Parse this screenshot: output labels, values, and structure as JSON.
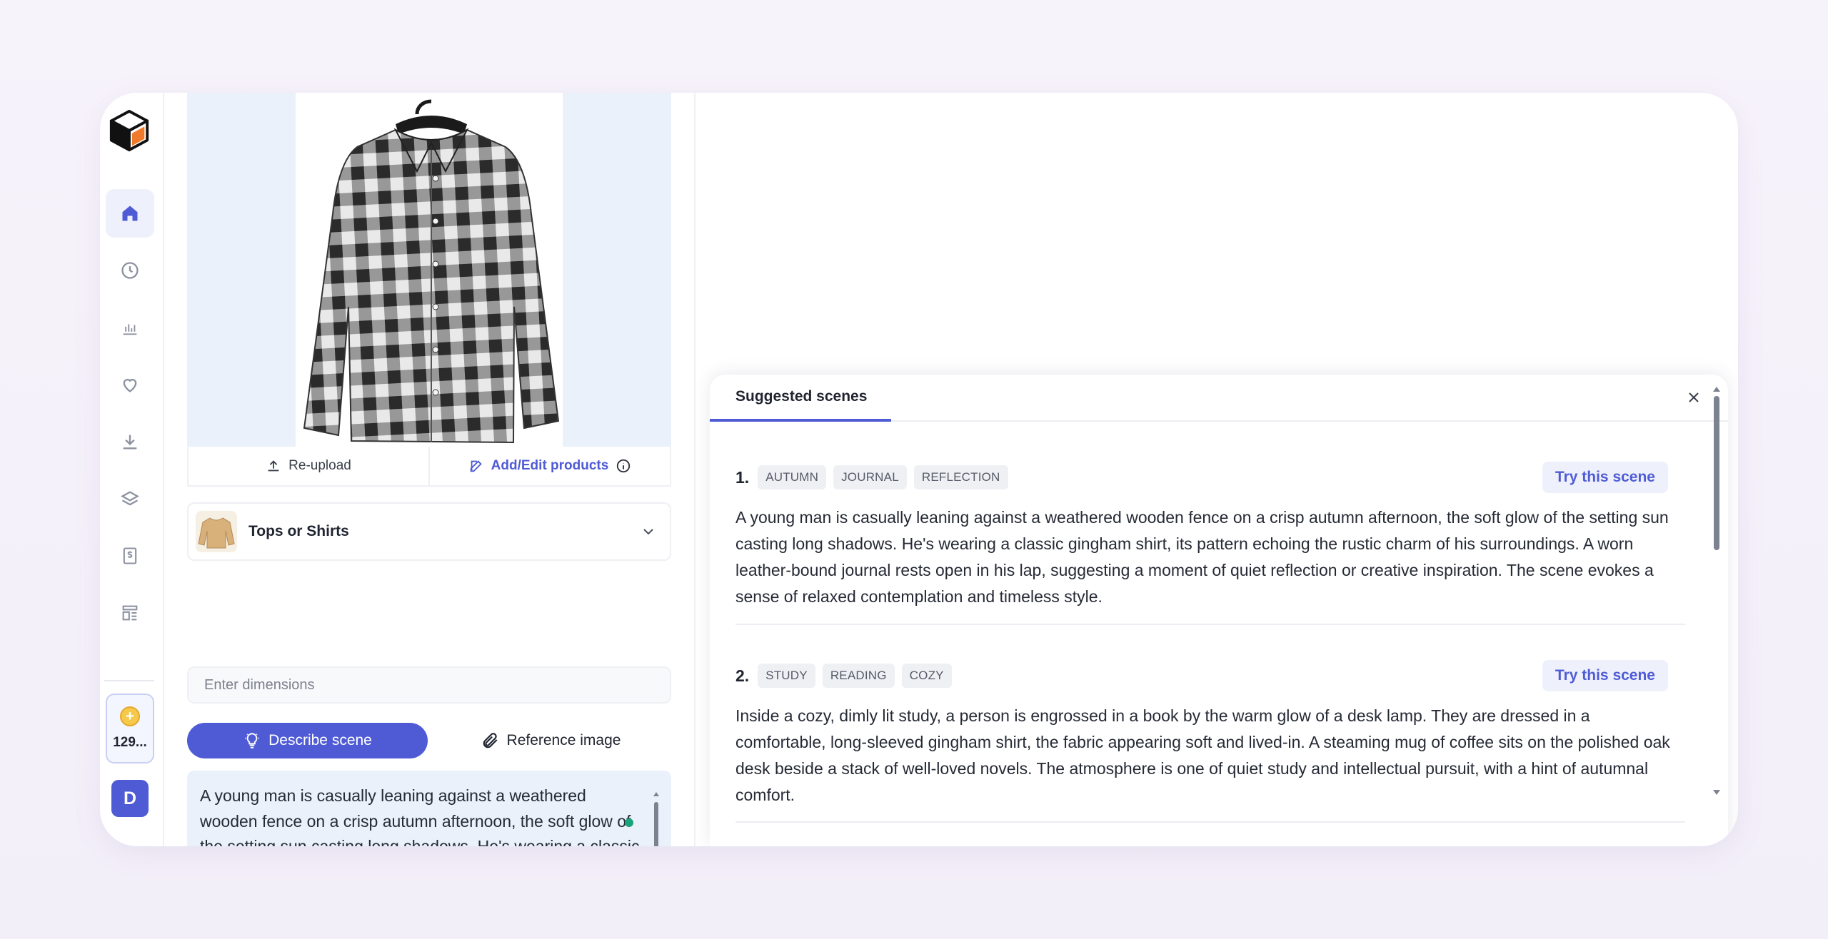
{
  "nav": {
    "items": [
      {
        "name": "home",
        "icon": "home-icon",
        "active": true
      },
      {
        "name": "history",
        "icon": "clock-icon",
        "active": false
      },
      {
        "name": "analytics",
        "icon": "bar-chart-icon",
        "active": false
      },
      {
        "name": "favorites",
        "icon": "heart-icon",
        "active": false
      },
      {
        "name": "downloads",
        "icon": "download-icon",
        "active": false
      },
      {
        "name": "layers",
        "icon": "layers-icon",
        "active": false
      },
      {
        "name": "billing",
        "icon": "dollar-document-icon",
        "active": false
      },
      {
        "name": "templates",
        "icon": "layout-list-icon",
        "active": false
      }
    ],
    "credits": "129...",
    "avatar_initial": "D"
  },
  "image_actions": {
    "reupload": "Re-upload",
    "add_edit": "Add/Edit products"
  },
  "category": {
    "label": "Tops or Shirts"
  },
  "dimensions": {
    "placeholder": "Enter dimensions"
  },
  "mode_tabs": {
    "describe": "Describe scene",
    "reference": "Reference image"
  },
  "description": "A young man is casually leaning against a weathered wooden fence on a crisp autumn afternoon, the soft glow of the setting sun casting long shadows. He's wearing a classic gingham shirt, its pattern echoing the rustic charm of his surroundings. A worn leather-bound journal rests open in his lap, suggesting a moment of quiet",
  "scenes_panel": {
    "title": "Suggested scenes",
    "try_label": "Try this scene",
    "scenes": [
      {
        "number": "1.",
        "tags": [
          "AUTUMN",
          "JOURNAL",
          "REFLECTION"
        ],
        "text": "A young man is casually leaning against a weathered wooden fence on a crisp autumn afternoon, the soft glow of the setting sun casting long shadows. He's wearing a classic gingham shirt, its pattern echoing the rustic charm of his surroundings. A worn leather-bound journal rests open in his lap, suggesting a moment of quiet reflection or creative inspiration. The scene evokes a sense of relaxed contemplation and timeless style."
      },
      {
        "number": "2.",
        "tags": [
          "STUDY",
          "READING",
          "COZY"
        ],
        "text": "Inside a cozy, dimly lit study, a person is engrossed in a book by the warm glow of a desk lamp. They are dressed in a comfortable, long-sleeved gingham shirt, the fabric appearing soft and lived-in. A steaming mug of coffee sits on the polished oak desk beside a stack of well-loved novels. The atmosphere is one of quiet study and intellectual pursuit, with a hint of autumnal comfort."
      }
    ]
  },
  "colors": {
    "accent": "#4f5bd5",
    "status_dot": "#1aa37a"
  }
}
